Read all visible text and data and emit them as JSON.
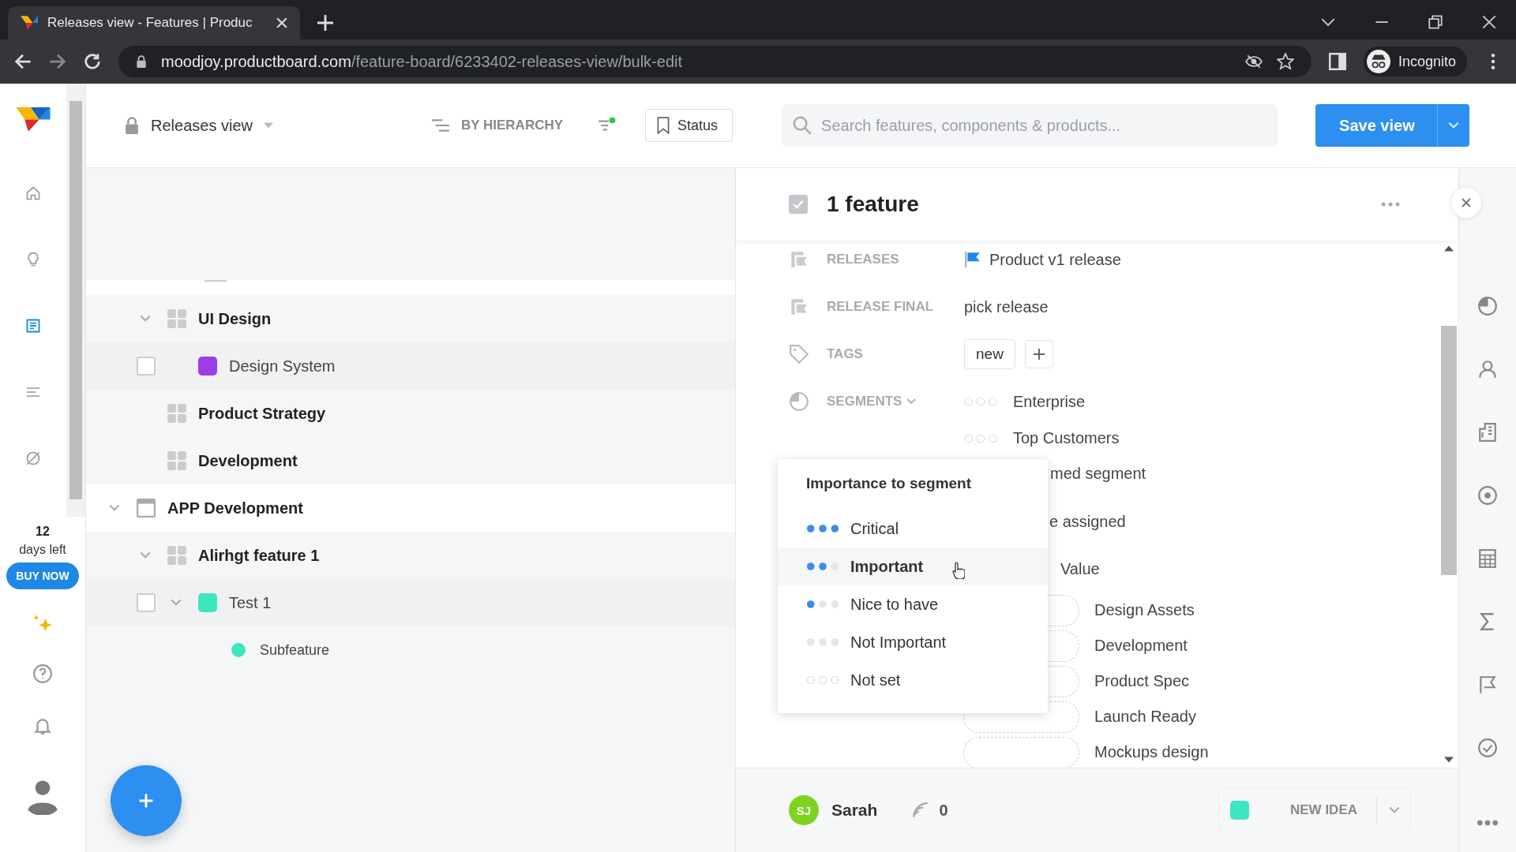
{
  "browser": {
    "tab_title": "Releases view - Features | Produc",
    "url_host": "moodjoy.productboard.com",
    "url_path": "/feature-board/6233402-releases-view/bulk-edit",
    "profile": "Incognito"
  },
  "rail": {
    "items": [
      {
        "kind": "home",
        "selected": false
      },
      {
        "kind": "bulb",
        "selected": false
      },
      {
        "kind": "board",
        "selected": true
      },
      {
        "kind": "list",
        "selected": false
      },
      {
        "kind": "hidden",
        "selected": false
      }
    ],
    "trial_days": "12",
    "trial_label": "days left",
    "buy_button": "BUY NOW"
  },
  "toolbar": {
    "view_name": "Releases view",
    "grouping": "BY HIERARCHY",
    "status_button": "Status",
    "search": {
      "placeholder": "Search features, components & products..."
    },
    "save_button": "Save view"
  },
  "tree": [
    {
      "kind": "component",
      "name": "UI Design",
      "expanded": true,
      "children": [
        {
          "kind": "feature",
          "name": "Design System",
          "color": "#9b3ee8",
          "checked": false
        }
      ]
    },
    {
      "kind": "component",
      "name": "Product Strategy"
    },
    {
      "kind": "component",
      "name": "Development"
    },
    {
      "kind": "product",
      "name": "APP Development",
      "expanded": true,
      "children": [
        {
          "kind": "component",
          "name": "Alirhgt feature 1",
          "expanded": true,
          "children": [
            {
              "kind": "feature",
              "name": "Test 1",
              "color": "#3ee6c0",
              "checked": false,
              "expanded": true,
              "children": [
                {
                  "kind": "subfeature",
                  "name": "Subfeature",
                  "color": "#3ee6c0"
                }
              ]
            }
          ]
        }
      ]
    }
  ],
  "panel": {
    "title": "1 feature",
    "checked": true,
    "fields": [
      {
        "kind": "releases",
        "label": "RELEASES",
        "value": "Product v1 release"
      },
      {
        "kind": "releases",
        "label": "RELEASE FINAL",
        "value": "pick release"
      },
      {
        "kind": "tags",
        "label": "TAGS",
        "tags": [
          "new"
        ]
      },
      {
        "kind": "segments",
        "label": "SEGMENTS"
      }
    ],
    "segments": [
      {
        "name": "Enterprise",
        "kind": "not_set"
      },
      {
        "name": "Top Customers",
        "kind": "not_set"
      },
      {
        "name": "med segment"
      }
    ],
    "covered_lines": [
      "e assigned",
      "Value"
    ],
    "stages": [
      "Design Assets",
      "Development",
      "Product Spec",
      "Launch Ready",
      "Mockups design"
    ]
  },
  "popup": {
    "title": "Importance to segment",
    "options": [
      {
        "label": "Critical",
        "kind": "critical",
        "selected": false
      },
      {
        "label": "Important",
        "kind": "important",
        "selected": true
      },
      {
        "label": "Nice to have",
        "kind": "nice",
        "selected": false
      },
      {
        "label": "Not Important",
        "kind": "not_important",
        "selected": false
      },
      {
        "label": "Not set",
        "kind": "not_set",
        "selected": false
      }
    ]
  },
  "footer": {
    "initials": "SJ",
    "owner": "Sarah",
    "votes": "0",
    "status": "NEW IDEA"
  }
}
